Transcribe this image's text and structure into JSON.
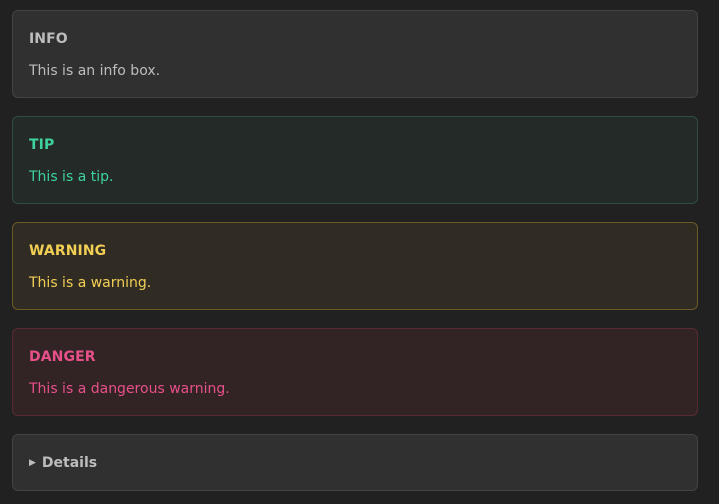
{
  "colors": {
    "background": "#212121",
    "info_text": "#bdbdbd",
    "tip_text": "#3ed39c",
    "warning_text": "#f1cf55",
    "danger_text": "#e8508a",
    "details_text": "#bdbdbd"
  },
  "admonitions": [
    {
      "type": "info",
      "title": "INFO",
      "body": "This is an info box."
    },
    {
      "type": "tip",
      "title": "TIP",
      "body": "This is a tip."
    },
    {
      "type": "warning",
      "title": "WARNING",
      "body": "This is a warning."
    },
    {
      "type": "danger",
      "title": "DANGER",
      "body": "This is a dangerous warning."
    }
  ],
  "details": {
    "icon": "triangle-right-icon",
    "label": "Details"
  }
}
